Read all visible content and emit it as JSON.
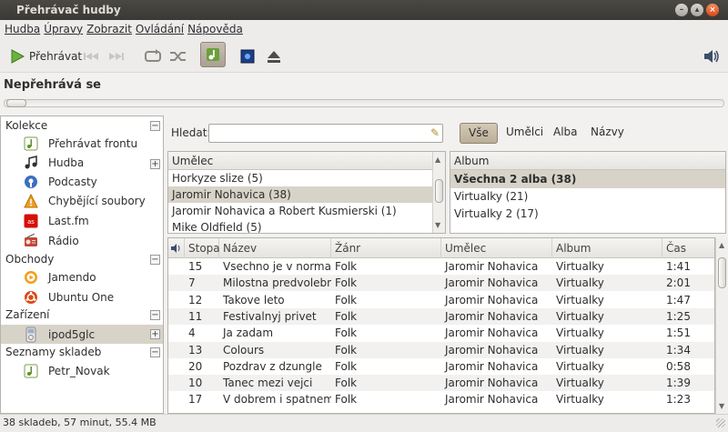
{
  "window": {
    "title": "Přehrávač hudby"
  },
  "menu": [
    "Hudba",
    "Úpravy",
    "Zobrazit",
    "Ovládání",
    "Nápověda"
  ],
  "toolbar": {
    "play_label": "Přehrávat"
  },
  "status": {
    "title": "Nepřehrává se"
  },
  "sidebar": {
    "sections": [
      {
        "label": "Kolekce",
        "items": [
          {
            "label": "Přehrávat frontu",
            "icon": "play-queue-icon"
          },
          {
            "label": "Hudba",
            "icon": "music-note-icon"
          },
          {
            "label": "Podcasty",
            "icon": "podcast-icon"
          },
          {
            "label": "Chybějící soubory",
            "icon": "warning-icon"
          },
          {
            "label": "Last.fm",
            "icon": "lastfm-icon"
          },
          {
            "label": "Rádio",
            "icon": "radio-icon"
          }
        ]
      },
      {
        "label": "Obchody",
        "items": [
          {
            "label": "Jamendo",
            "icon": "jamendo-icon"
          },
          {
            "label": "Ubuntu One",
            "icon": "ubuntu-one-icon"
          }
        ]
      },
      {
        "label": "Zařízení",
        "items": [
          {
            "label": "ipod5glc",
            "icon": "ipod-icon"
          }
        ]
      },
      {
        "label": "Seznamy skladeb",
        "items": [
          {
            "label": "Petr_Novak",
            "icon": "playlist-icon"
          }
        ]
      }
    ]
  },
  "search": {
    "label": "Hledat:",
    "value": ""
  },
  "filters": [
    "Vše",
    "Umělci",
    "Alba",
    "Názvy"
  ],
  "artist_pane": {
    "header": "Umělec",
    "rows": [
      "Horkyze slize (5)",
      "Jaromir Nohavica (38)",
      "Jaromir Nohavica a Robert Kusmierski (1)",
      "Mike Oldfield (5)"
    ]
  },
  "album_pane": {
    "header": "Album",
    "rows": [
      "Všechna 2 alba (38)",
      "Virtualky (21)",
      "Virtualky 2 (17)"
    ]
  },
  "tracks": {
    "headers": [
      "Stopa",
      "Název",
      "Žánr",
      "Umělec",
      "Album",
      "Čas"
    ],
    "rows": [
      [
        "15",
        "Vsechno je v normalu",
        "Folk",
        "Jaromir Nohavica",
        "Virtualky",
        "1:41"
      ],
      [
        "7",
        "Milostna predvolebni",
        "Folk",
        "Jaromir Nohavica",
        "Virtualky",
        "2:01"
      ],
      [
        "12",
        "Takove leto",
        "Folk",
        "Jaromir Nohavica",
        "Virtualky",
        "1:47"
      ],
      [
        "11",
        "Festivalnyj privet",
        "Folk",
        "Jaromir Nohavica",
        "Virtualky",
        "1:25"
      ],
      [
        "4",
        "Ja zadam",
        "Folk",
        "Jaromir Nohavica",
        "Virtualky",
        "1:51"
      ],
      [
        "13",
        "Colours",
        "Folk",
        "Jaromir Nohavica",
        "Virtualky",
        "1:34"
      ],
      [
        "20",
        "Pozdrav z dzungle",
        "Folk",
        "Jaromir Nohavica",
        "Virtualky",
        "0:58"
      ],
      [
        "10",
        "Tanec mezi vejci",
        "Folk",
        "Jaromir Nohavica",
        "Virtualky",
        "1:39"
      ],
      [
        "17",
        "V dobrem i spatnem",
        "Folk",
        "Jaromir Nohavica",
        "Virtualky",
        "1:23"
      ]
    ]
  },
  "statusbar": {
    "text": "38 skladeb, 57 minut, 55.4 MB"
  },
  "colors": {
    "titlebar": "#3b3935",
    "selection": "#d8d3c8",
    "accent": "#dd4814"
  }
}
